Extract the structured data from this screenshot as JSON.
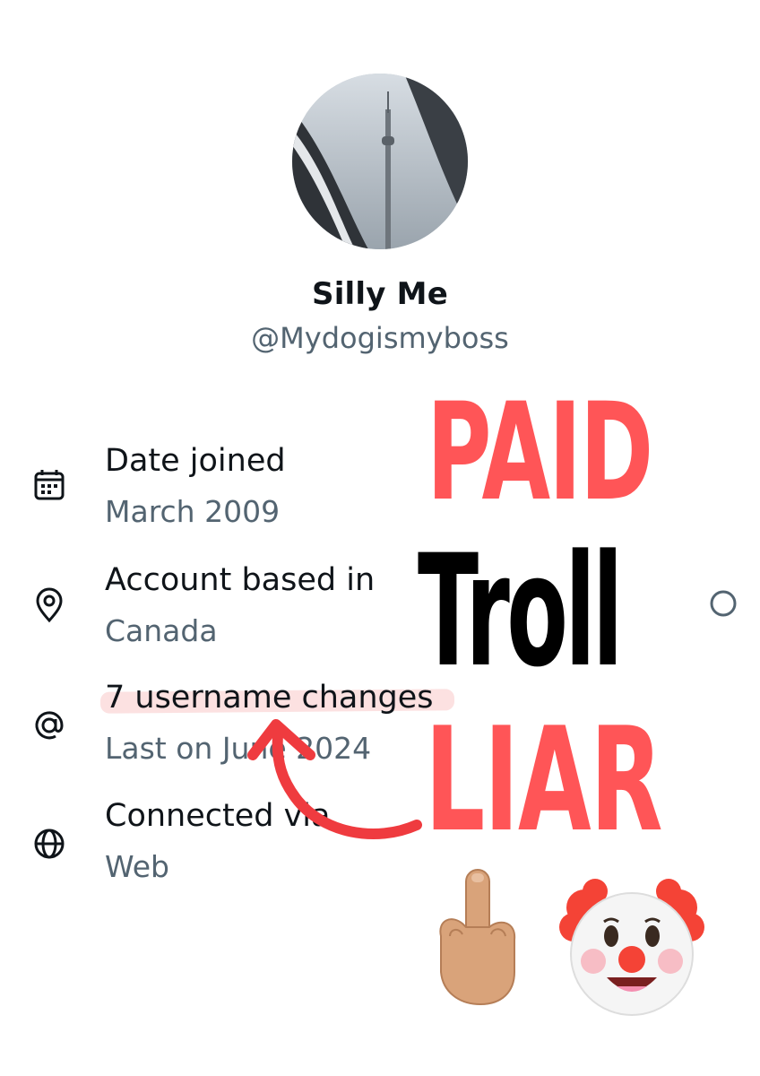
{
  "profile": {
    "display_name": "Silly Me",
    "handle": "@Mydogismyboss"
  },
  "about": [
    {
      "icon": "calendar-icon",
      "title": "Date joined",
      "subtitle": "March 2009"
    },
    {
      "icon": "location-pin-icon",
      "title": "Account based in",
      "subtitle": "Canada"
    },
    {
      "icon": "at-sign-icon",
      "title": "7 username changes",
      "subtitle": "Last on June 2024"
    },
    {
      "icon": "globe-icon",
      "title": "Connected via",
      "subtitle": "Web"
    }
  ],
  "overlay": {
    "line1": "PAID",
    "line2": "Troll",
    "line3": "LIAR",
    "emojis": [
      "middle-finger-emoji",
      "clown-face-emoji"
    ],
    "colors": {
      "red": "#ff5557",
      "black": "#000000",
      "highlight": "#f4c3c3"
    }
  },
  "colors": {
    "primary_text": "#0f1419",
    "secondary_text": "#536471"
  }
}
